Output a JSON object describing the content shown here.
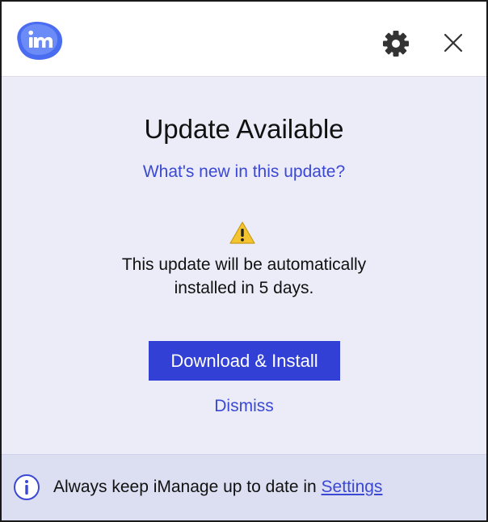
{
  "colors": {
    "accent": "#3340d6",
    "link": "#3b48d4",
    "body_background": "#ebecf7",
    "footer_background": "#dcdef2",
    "warning": "#f4c430"
  },
  "header": {
    "logo_icon": "imanage-logo-icon",
    "settings_icon": "gear-icon",
    "close_icon": "close-icon"
  },
  "main": {
    "title": "Update Available",
    "whats_new_link": "What's new in this update?",
    "warning_icon": "warning-triangle-icon",
    "message_line1": "This update will be automatically",
    "message_line2": "installed in 5 days.",
    "primary_button": "Download & Install",
    "dismiss_link": "Dismiss"
  },
  "footer": {
    "info_icon": "info-icon",
    "text": "Always keep iManage up to date in ",
    "settings_link": "Settings"
  }
}
